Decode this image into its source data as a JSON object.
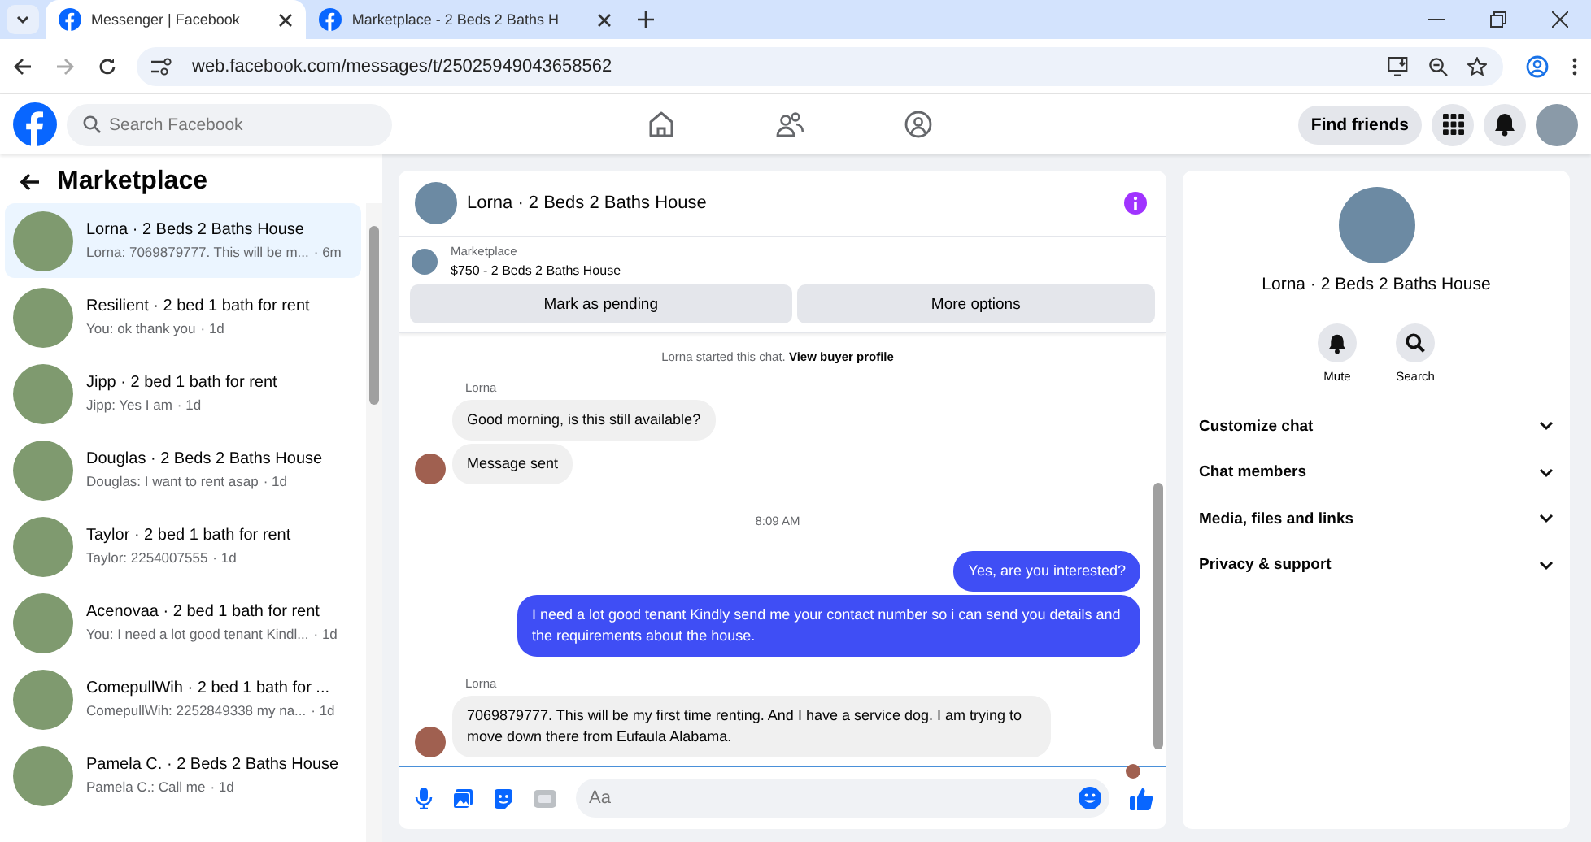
{
  "browser": {
    "tabs": [
      {
        "title": "Messenger | Facebook",
        "selected": true
      },
      {
        "title": "Marketplace - 2 Beds 2 Baths H",
        "selected": false
      }
    ],
    "url": "web.facebook.com/messages/t/25025949043658562"
  },
  "header": {
    "search_placeholder": "Search Facebook",
    "find_friends": "Find friends"
  },
  "sidebar": {
    "title": "Marketplace",
    "conversations": [
      {
        "title": "Lorna · 2 Beds 2 Baths House",
        "preview": "Lorna: 7069879777. This will be m...",
        "time": "· 6m",
        "selected": true
      },
      {
        "title": "Resilient · 2 bed 1 bath for rent",
        "preview": "You: ok thank you",
        "time": "· 1d",
        "selected": false
      },
      {
        "title": "Jipp · 2 bed 1 bath for rent",
        "preview": "Jipp: Yes I am",
        "time": "· 1d",
        "selected": false
      },
      {
        "title": "Douglas · 2 Beds 2 Baths House",
        "preview": "Douglas: I want to rent asap",
        "time": "· 1d",
        "selected": false
      },
      {
        "title": "Taylor · 2 bed 1 bath for rent",
        "preview": "Taylor: 2254007555",
        "time": "· 1d",
        "selected": false
      },
      {
        "title": "Acenovaa · 2 bed 1 bath for rent",
        "preview": "You: I need a lot good tenant Kindl...",
        "time": "· 1d",
        "selected": false
      },
      {
        "title": "ComepullWih · 2 bed 1 bath for ...",
        "preview": "ComepullWih: 2252849338 my na...",
        "time": "· 1d",
        "selected": false
      },
      {
        "title": "Pamela C. · 2 Beds 2 Baths House",
        "preview": "Pamela C.: Call me",
        "time": "· 1d",
        "selected": false
      }
    ]
  },
  "chat": {
    "title": "Lorna · 2 Beds 2 Baths House",
    "listing": {
      "label": "Marketplace",
      "name": "$750 - 2 Beds 2 Baths House",
      "buttons": [
        "Mark as pending",
        "More options"
      ]
    },
    "messages": [
      {
        "kind": "system",
        "text": "Lorna started this chat.",
        "link": "View buyer profile"
      },
      {
        "kind": "sender",
        "text": "Lorna"
      },
      {
        "kind": "incoming",
        "text": "Good morning, is this still available?",
        "avatar": false
      },
      {
        "kind": "incoming",
        "text": "Message sent",
        "avatar": true
      },
      {
        "kind": "time",
        "text": "8:09 AM"
      },
      {
        "kind": "outgoing",
        "text": "Yes, are you interested?"
      },
      {
        "kind": "outgoing",
        "text": "I need a lot good tenant Kindly send me your contact number so i can send you details and the requirements about the house."
      },
      {
        "kind": "sender",
        "text": "Lorna"
      },
      {
        "kind": "incoming",
        "text": "7069879777. This will be my first time renting. And I have a service dog. I am trying to move down there from Eufaula Alabama.",
        "avatar": true
      }
    ],
    "composer": {
      "placeholder": "Aa"
    }
  },
  "details": {
    "title": "Lorna · 2 Beds 2 Baths House",
    "actions": [
      {
        "kind": "mute",
        "label": "Mute"
      },
      {
        "kind": "search",
        "label": "Search"
      }
    ],
    "sections": [
      {
        "label": "Customize chat",
        "expanded": false
      },
      {
        "label": "Chat members",
        "expanded": false
      },
      {
        "label": "Media, files and links",
        "expanded": false
      },
      {
        "label": "Privacy & support",
        "expanded": false
      }
    ]
  }
}
